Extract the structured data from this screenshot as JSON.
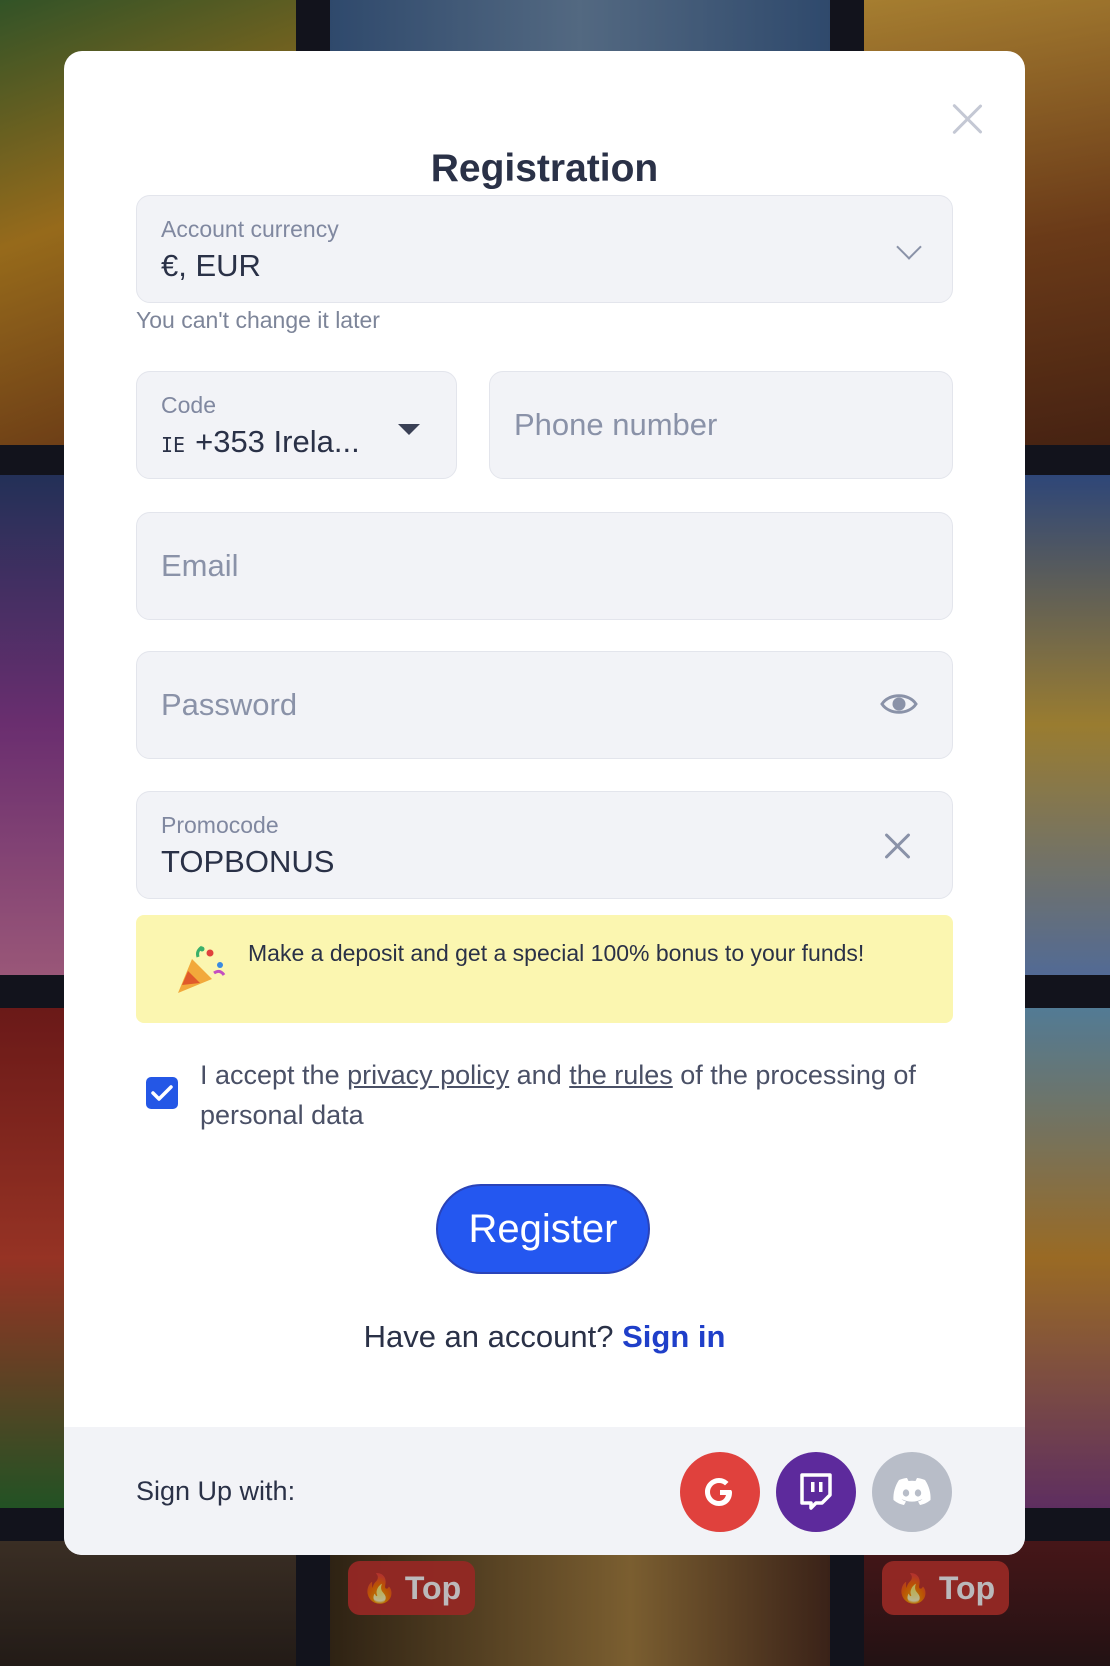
{
  "modal": {
    "title": "Registration"
  },
  "currency": {
    "label": "Account currency",
    "value": "€, EUR",
    "hint": "You can't change it later"
  },
  "phone": {
    "code_label": "Code",
    "code_flag": "IE",
    "code_value": "+353 Irela...",
    "placeholder": "Phone number"
  },
  "email": {
    "placeholder": "Email"
  },
  "password": {
    "placeholder": "Password"
  },
  "promocode": {
    "label": "Promocode",
    "value": "TOPBONUS"
  },
  "bonus": {
    "text": "Make a deposit and get a special 100% bonus to your funds!"
  },
  "consent": {
    "checked": true,
    "prefix": "I accept the ",
    "privacy_link": "privacy policy",
    "middle": " and ",
    "rules_link": "the rules",
    "suffix": " of the processing of personal data"
  },
  "register": {
    "label": "Register"
  },
  "signin": {
    "prompt": "Have an account?",
    "link": "Sign in"
  },
  "footer": {
    "label": "Sign Up with:",
    "providers": [
      {
        "name": "google-icon",
        "color": "#e0413d"
      },
      {
        "name": "twitch-icon",
        "color": "#5d2a9c"
      },
      {
        "name": "discord-icon",
        "color": "#b8bdc8"
      }
    ]
  },
  "background": {
    "badges": [
      "Top",
      "Top"
    ]
  },
  "colors": {
    "accent": "#2457f0",
    "link": "#1f3fc9",
    "bonus_bg": "#fbf6b0"
  }
}
